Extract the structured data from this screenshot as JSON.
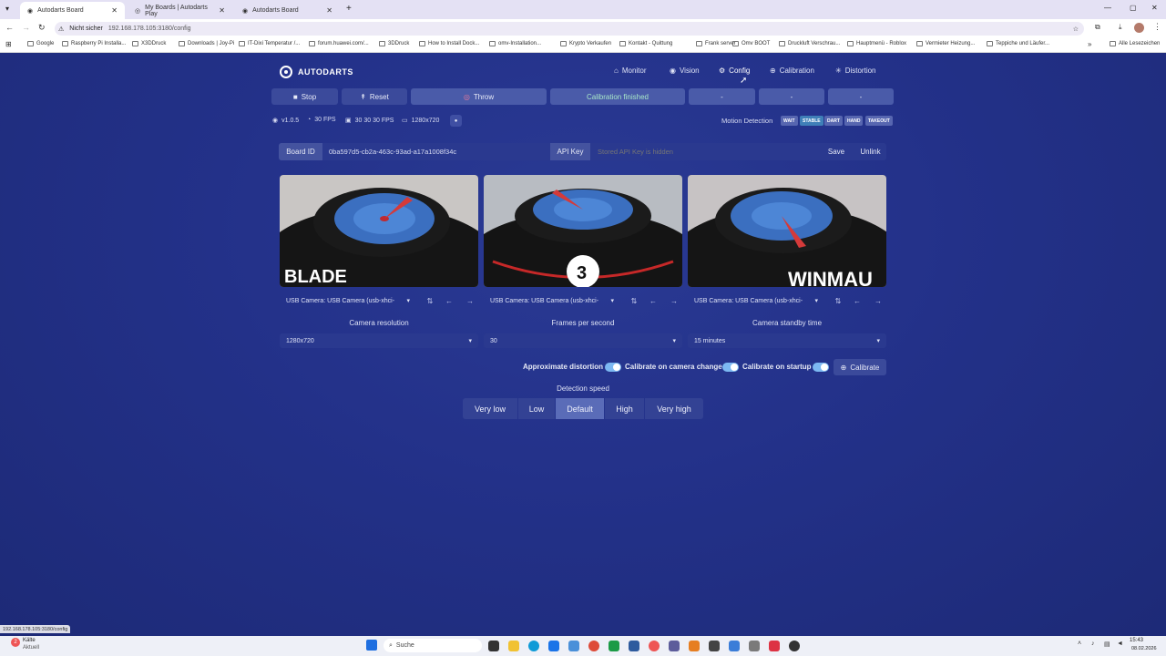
{
  "browser": {
    "tabs": [
      {
        "title": "Autodarts Board",
        "active": true
      },
      {
        "title": "My Boards | Autodarts Play",
        "active": false
      },
      {
        "title": "Autodarts Board",
        "active": false
      }
    ],
    "security_label": "Nicht sicher",
    "url": "192.168.178.105:3180/config",
    "bookmarks": [
      "Google",
      "Raspberry Pi Installa...",
      "X3DDruck",
      "Downloads | Joy-Pi",
      "IT-Dixi Temperatur /...",
      "forum.huawei.com/...",
      "3DDruck",
      "How to Install Dock...",
      "omv-Installation...",
      "Krypto Verkaufen",
      "Kontakt - Quittung",
      "Frank server",
      "Omv BOOT",
      "Druckluft Verschrau...",
      "Hauptmenü - Roblox",
      "Vermieter Heizung...",
      "Teppiche und Läufer..."
    ],
    "bookmarks_more": "»",
    "all_bookmarks": "Alle Lesezeichen",
    "status_url": "192.168.178.105:3180/config"
  },
  "app": {
    "brand": "AUTODARTS",
    "nav": [
      {
        "label": "Monitor",
        "icon": "home-icon"
      },
      {
        "label": "Vision",
        "icon": "eye-icon"
      },
      {
        "label": "Config",
        "icon": "gear-icon",
        "active": true
      },
      {
        "label": "Calibration",
        "icon": "crosshair-icon"
      },
      {
        "label": "Distortion",
        "icon": "asterisk-icon"
      }
    ],
    "controls": {
      "stop": "Stop",
      "reset": "Reset",
      "throw": "Throw",
      "status": "Calibration finished",
      "slots": [
        "-",
        "-",
        "-"
      ]
    },
    "info": {
      "version": "v1.0.5",
      "fps": "30 FPS",
      "cam_fps": "30 30 30 FPS",
      "resolution": "1280x720",
      "motion_label": "Motion Detection",
      "motion_states": [
        "WAIT",
        "STABLE",
        "DART",
        "HAND",
        "TAKEOUT"
      ]
    },
    "board": {
      "board_id_label": "Board ID",
      "board_id": "0ba597d5-cb2a-463c-93ad-a17a1008f34c",
      "api_key_label": "API Key",
      "api_key_placeholder": "Stored API Key is hidden",
      "save": "Save",
      "unlink": "Unlink"
    },
    "cameras": [
      {
        "select": "USB Camera: USB Camera (usb-xhci-",
        "branding": "BLADE"
      },
      {
        "select": "USB Camera: USB Camera (usb-xhci-",
        "branding": "3"
      },
      {
        "select": "USB Camera: USB Camera (usb-xhci-",
        "branding": "WINMAU"
      }
    ],
    "settings": {
      "resolution_label": "Camera resolution",
      "resolution_value": "1280x720",
      "fps_label": "Frames per second",
      "fps_value": "30",
      "standby_label": "Camera standby time",
      "standby_value": "15 minutes"
    },
    "toggles": {
      "approx_distortion": "Approximate distortion",
      "calib_on_camera_change": "Calibrate on camera change",
      "calib_on_startup": "Calibrate on startup",
      "calibrate_button": "Calibrate"
    },
    "detection": {
      "label": "Detection speed",
      "options": [
        "Very low",
        "Low",
        "Default",
        "High",
        "Very high"
      ],
      "selected": "Default"
    }
  },
  "taskbar": {
    "weather_title": "Kälte",
    "weather_sub": "Aktuell",
    "weather_badge": "2",
    "search": "Suche",
    "time": "15:43",
    "date": "08.02.2026"
  },
  "colors": {
    "accent": "#7cb8f2",
    "background": "#233189"
  }
}
